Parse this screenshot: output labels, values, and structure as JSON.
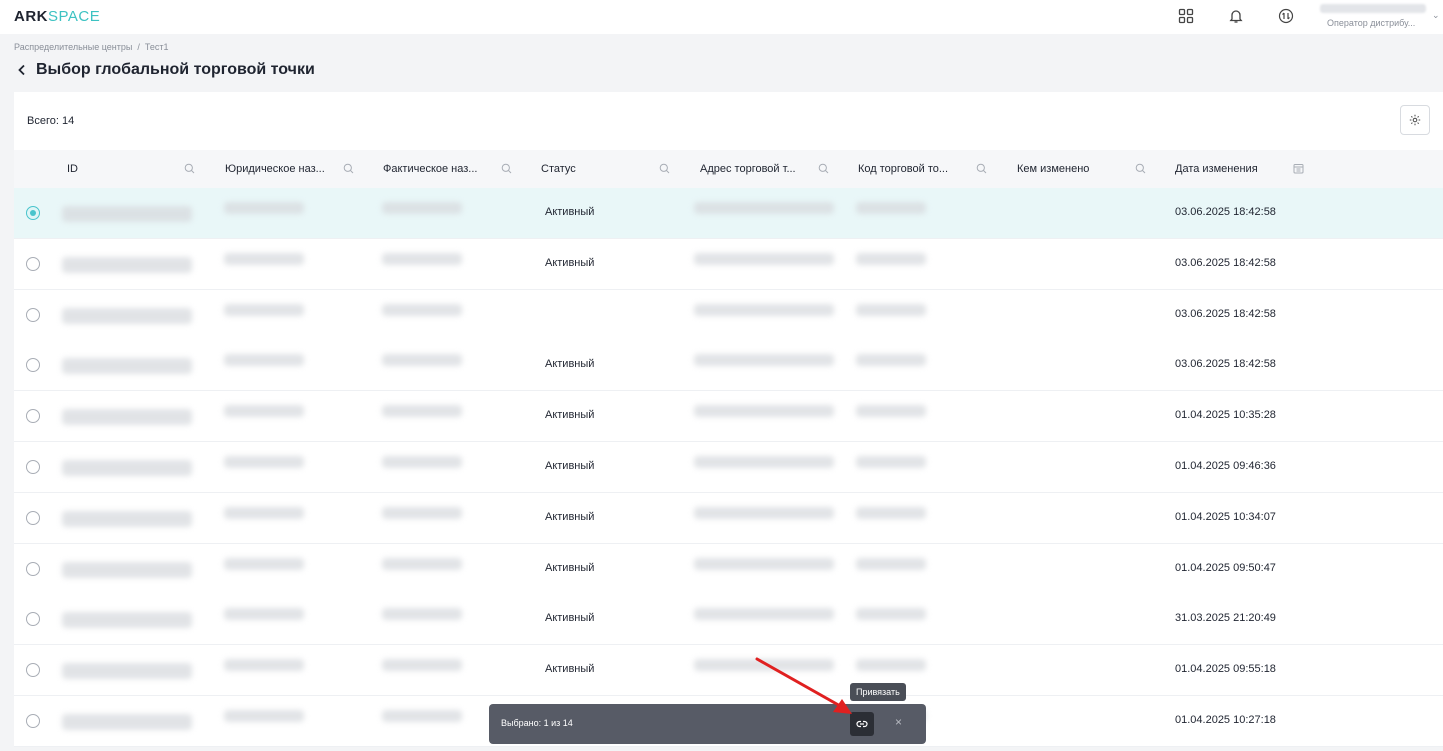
{
  "header": {
    "logo_bold": "ARK",
    "logo_light": "SPACE",
    "user_role": "Оператор дистрибу..."
  },
  "breadcrumb": {
    "items": [
      "Распределительные центры",
      "Тест1"
    ],
    "separator": "/"
  },
  "page": {
    "title": "Выбор глобальной торговой точки"
  },
  "table": {
    "total": "Всего: 14",
    "columns": [
      "ID",
      "Юридическое наз...",
      "Фактическое наз...",
      "Статус",
      "Адрес торговой т...",
      "Код торговой то...",
      "Кем изменено",
      "Дата изменения"
    ],
    "rows": [
      {
        "status": "Активный",
        "date": "03.06.2025 18:42:58",
        "selected": true
      },
      {
        "status": "Активный",
        "date": "03.06.2025 18:42:58",
        "selected": false
      },
      {
        "status": "",
        "date": "03.06.2025 18:42:58",
        "selected": false
      },
      {
        "status": "Активный",
        "date": "03.06.2025 18:42:58",
        "selected": false
      },
      {
        "status": "Активный",
        "date": "01.04.2025 10:35:28",
        "selected": false
      },
      {
        "status": "Активный",
        "date": "01.04.2025 09:46:36",
        "selected": false
      },
      {
        "status": "Активный",
        "date": "01.04.2025 10:34:07",
        "selected": false
      },
      {
        "status": "Активный",
        "date": "01.04.2025 09:50:47",
        "selected": false
      },
      {
        "status": "Активный",
        "date": "31.03.2025 21:20:49",
        "selected": false
      },
      {
        "status": "Активный",
        "date": "01.04.2025 09:55:18",
        "selected": false
      },
      {
        "status": "",
        "date": "01.04.2025 10:27:18",
        "selected": false
      }
    ]
  },
  "action_bar": {
    "selected_text": "Выбрано: 1 из 14",
    "link_tooltip": "Привязать",
    "close_symbol": "×"
  },
  "icons": {
    "apps": "grid-apps-icon",
    "notifications": "bell-icon",
    "sync": "exchange-icon",
    "settings": "gear-icon",
    "link": "link-icon",
    "search": "search-icon",
    "calendar": "calendar-icon"
  },
  "colors": {
    "accent": "#49c4cc",
    "logo_light": "#3cc2c2",
    "selected_row": "#e9f7f8",
    "action_bar": "#575b66",
    "arrow": "#e02020"
  }
}
